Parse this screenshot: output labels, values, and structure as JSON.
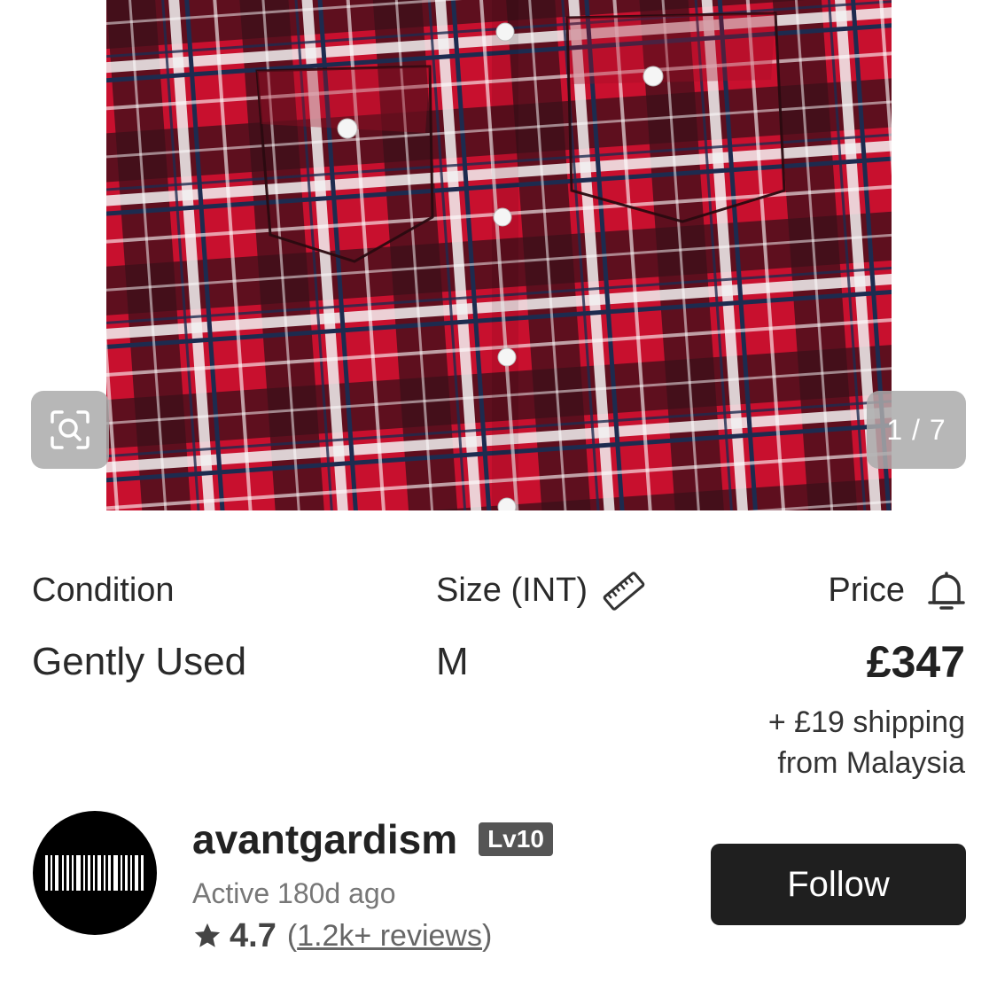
{
  "gallery": {
    "counter": "1 / 7"
  },
  "details": {
    "condition_label": "Condition",
    "condition_value": "Gently Used",
    "size_label": "Size (INT)",
    "size_value": "M",
    "price_label": "Price",
    "price_value": "£347",
    "shipping_line1": "+ £19 shipping",
    "shipping_line2": "from Malaysia"
  },
  "seller": {
    "name": "avantgardism",
    "level": "Lv10",
    "active": "Active 180d ago",
    "rating": "4.7",
    "reviews_open": "(",
    "reviews_link": "1.2k+ reviews",
    "reviews_close": ")",
    "follow_label": "Follow"
  },
  "colors": {
    "plaid_red": "#c8102e",
    "plaid_navy": "#1d2b4f",
    "button_dark": "#1f1f1f",
    "badge": "#555555"
  },
  "icons": {
    "zoom": "zoom-scan-icon",
    "ruler": "ruler-icon",
    "bell": "bell-icon",
    "star": "star-icon"
  }
}
